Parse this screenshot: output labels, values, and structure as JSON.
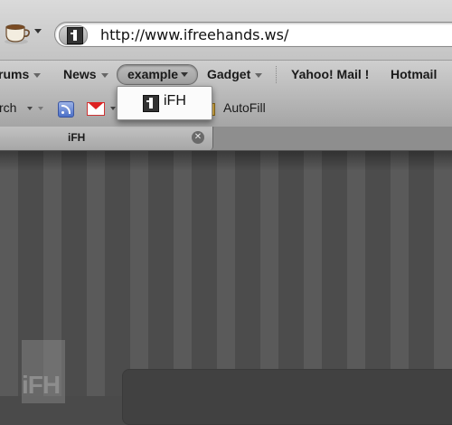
{
  "toolbar": {
    "app_icon": "coffee-cup-icon",
    "url": "http://www.ifreehands.ws/",
    "site_icon": "info-i-icon"
  },
  "bookmarks": {
    "items": [
      {
        "label": "rums"
      },
      {
        "label": "News"
      },
      {
        "label": "example"
      },
      {
        "label": "Gadget"
      },
      {
        "label": "Yahoo! Mail !"
      },
      {
        "label": "Hotmail"
      }
    ]
  },
  "extbar": {
    "search_label": "rch",
    "autofill_label": "AutoFill",
    "icons": [
      "rss-icon",
      "gmail-icon",
      "autofill-icon"
    ]
  },
  "tabs": [
    {
      "label": "iFH"
    }
  ],
  "content": {
    "logo_text": "iFH"
  },
  "dropdown": {
    "items": [
      {
        "label": "iFH",
        "icon": "info-i-icon"
      }
    ]
  },
  "colors": {
    "page_stripe_light": "#5a5a5a",
    "page_stripe_dark": "#4c4c4c",
    "chrome": "#c4c4c4"
  }
}
